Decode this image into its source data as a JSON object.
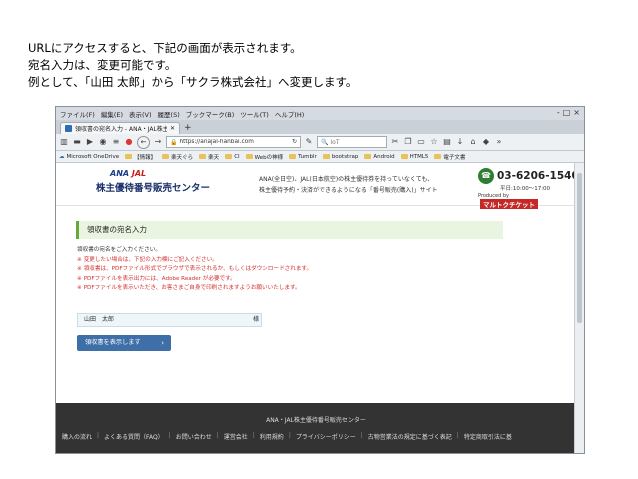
{
  "intro": {
    "line1": "URLにアクセスすると、下記の画面が表示されます。",
    "line2": "宛名入力は、変更可能です。",
    "line3": "例として、「山田 太郎」から「サクラ株式会社」へ変更します。"
  },
  "browser": {
    "menu": [
      "ファイル(F)",
      "編集(E)",
      "表示(V)",
      "履歴(S)",
      "ブックマーク(B)",
      "ツール(T)",
      "ヘルプ(H)"
    ],
    "window_controls": [
      "-",
      "□",
      "×"
    ],
    "tab_title": "領収書の宛名入力 - ANA・JAL株主優",
    "new_tab": "+",
    "search_placeholder": "IoT",
    "url": "https://anajal-hanbai.com",
    "bookmarks": [
      "Microsoft OneDrive",
      "【情報】",
      "楽天ぐら",
      "楽天",
      "CI",
      "Webの神様",
      "Tumblr",
      "bootstrap",
      "Android",
      "HTML5",
      "電子文書"
    ]
  },
  "site": {
    "brand_ana": "ANA",
    "brand_jal": "JAL",
    "site_name": "株主優待番号販売センター",
    "tagline1": "ANA(全日空)、JAL(日本航空)の株主優待券を持っていなくても、",
    "tagline2": "株主優待予約・決済ができるようになる「番号販売(購入)」サイト",
    "phone": "03-6206-1540",
    "hours": "平日:10:00〜17:00",
    "produced_by": "Produced by",
    "producer": "マルトクチケット",
    "section_title": "領収書の宛名入力",
    "instruction": "領収書の宛名をご入力ください。",
    "notes": [
      "変更したい場合は、下記の入力欄にご記入ください。",
      "領収書は、PDFファイル形式でブラウザで表示されるか、もしくはダウンロードされます。",
      "PDFファイルを表示出力には、Adobe Reader が必要です。",
      "PDFファイルを表示いただき、お客さまご自身で印刷されますようお願いいたします。"
    ],
    "note_mark": "※",
    "name_value": "山田　太郎",
    "name_suffix": "様",
    "submit_label": "領収書を表示します",
    "submit_chevron": "›",
    "footer_title": "ANA・JAL株主優待番号販売センター",
    "footer_links": [
      "購入の流れ",
      "よくある質問（FAQ）",
      "お問い合わせ",
      "運営会社",
      "利用規約",
      "プライバシーポリシー",
      "古物営業法の規定に基づく表記",
      "特定商取引法に基"
    ]
  },
  "colors": {
    "section_border": "#66a83c",
    "section_bg": "#e9f5e1",
    "note_red": "#d32f2f",
    "button_blue": "#3e6fa8",
    "footer_bg": "#333333"
  }
}
